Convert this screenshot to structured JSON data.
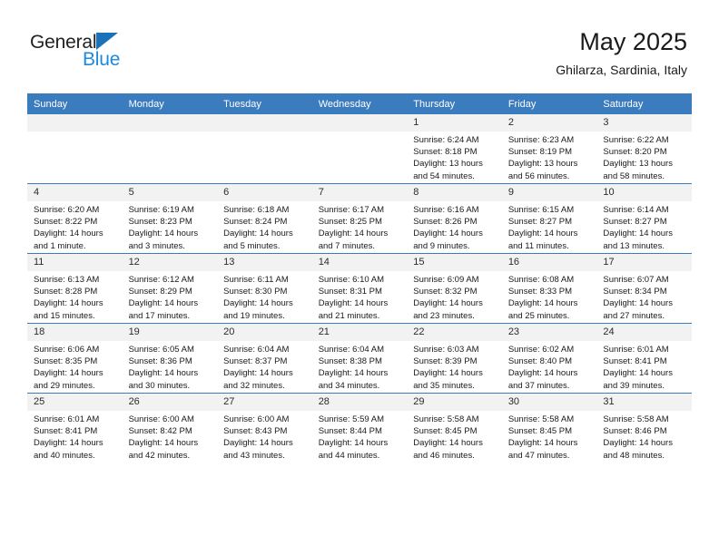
{
  "brand": {
    "word1": "General",
    "word2": "Blue",
    "triangle_color": "#1b72b8",
    "blue_text_color": "#1b8ae0"
  },
  "header": {
    "title": "May 2025",
    "subtitle": "Ghilarza, Sardinia, Italy"
  },
  "theme": {
    "header_blue": "#3b7cbf",
    "daynum_bg": "#f2f2f2",
    "text": "#1a1a1a"
  },
  "weekdays": [
    "Sunday",
    "Monday",
    "Tuesday",
    "Wednesday",
    "Thursday",
    "Friday",
    "Saturday"
  ],
  "weeks": [
    [
      {
        "day": "",
        "empty": true
      },
      {
        "day": "",
        "empty": true
      },
      {
        "day": "",
        "empty": true
      },
      {
        "day": "",
        "empty": true
      },
      {
        "day": "1",
        "sunrise": "Sunrise: 6:24 AM",
        "sunset": "Sunset: 8:18 PM",
        "daylight": "Daylight: 13 hours and 54 minutes."
      },
      {
        "day": "2",
        "sunrise": "Sunrise: 6:23 AM",
        "sunset": "Sunset: 8:19 PM",
        "daylight": "Daylight: 13 hours and 56 minutes."
      },
      {
        "day": "3",
        "sunrise": "Sunrise: 6:22 AM",
        "sunset": "Sunset: 8:20 PM",
        "daylight": "Daylight: 13 hours and 58 minutes."
      }
    ],
    [
      {
        "day": "4",
        "sunrise": "Sunrise: 6:20 AM",
        "sunset": "Sunset: 8:22 PM",
        "daylight": "Daylight: 14 hours and 1 minute."
      },
      {
        "day": "5",
        "sunrise": "Sunrise: 6:19 AM",
        "sunset": "Sunset: 8:23 PM",
        "daylight": "Daylight: 14 hours and 3 minutes."
      },
      {
        "day": "6",
        "sunrise": "Sunrise: 6:18 AM",
        "sunset": "Sunset: 8:24 PM",
        "daylight": "Daylight: 14 hours and 5 minutes."
      },
      {
        "day": "7",
        "sunrise": "Sunrise: 6:17 AM",
        "sunset": "Sunset: 8:25 PM",
        "daylight": "Daylight: 14 hours and 7 minutes."
      },
      {
        "day": "8",
        "sunrise": "Sunrise: 6:16 AM",
        "sunset": "Sunset: 8:26 PM",
        "daylight": "Daylight: 14 hours and 9 minutes."
      },
      {
        "day": "9",
        "sunrise": "Sunrise: 6:15 AM",
        "sunset": "Sunset: 8:27 PM",
        "daylight": "Daylight: 14 hours and 11 minutes."
      },
      {
        "day": "10",
        "sunrise": "Sunrise: 6:14 AM",
        "sunset": "Sunset: 8:27 PM",
        "daylight": "Daylight: 14 hours and 13 minutes."
      }
    ],
    [
      {
        "day": "11",
        "sunrise": "Sunrise: 6:13 AM",
        "sunset": "Sunset: 8:28 PM",
        "daylight": "Daylight: 14 hours and 15 minutes."
      },
      {
        "day": "12",
        "sunrise": "Sunrise: 6:12 AM",
        "sunset": "Sunset: 8:29 PM",
        "daylight": "Daylight: 14 hours and 17 minutes."
      },
      {
        "day": "13",
        "sunrise": "Sunrise: 6:11 AM",
        "sunset": "Sunset: 8:30 PM",
        "daylight": "Daylight: 14 hours and 19 minutes."
      },
      {
        "day": "14",
        "sunrise": "Sunrise: 6:10 AM",
        "sunset": "Sunset: 8:31 PM",
        "daylight": "Daylight: 14 hours and 21 minutes."
      },
      {
        "day": "15",
        "sunrise": "Sunrise: 6:09 AM",
        "sunset": "Sunset: 8:32 PM",
        "daylight": "Daylight: 14 hours and 23 minutes."
      },
      {
        "day": "16",
        "sunrise": "Sunrise: 6:08 AM",
        "sunset": "Sunset: 8:33 PM",
        "daylight": "Daylight: 14 hours and 25 minutes."
      },
      {
        "day": "17",
        "sunrise": "Sunrise: 6:07 AM",
        "sunset": "Sunset: 8:34 PM",
        "daylight": "Daylight: 14 hours and 27 minutes."
      }
    ],
    [
      {
        "day": "18",
        "sunrise": "Sunrise: 6:06 AM",
        "sunset": "Sunset: 8:35 PM",
        "daylight": "Daylight: 14 hours and 29 minutes."
      },
      {
        "day": "19",
        "sunrise": "Sunrise: 6:05 AM",
        "sunset": "Sunset: 8:36 PM",
        "daylight": "Daylight: 14 hours and 30 minutes."
      },
      {
        "day": "20",
        "sunrise": "Sunrise: 6:04 AM",
        "sunset": "Sunset: 8:37 PM",
        "daylight": "Daylight: 14 hours and 32 minutes."
      },
      {
        "day": "21",
        "sunrise": "Sunrise: 6:04 AM",
        "sunset": "Sunset: 8:38 PM",
        "daylight": "Daylight: 14 hours and 34 minutes."
      },
      {
        "day": "22",
        "sunrise": "Sunrise: 6:03 AM",
        "sunset": "Sunset: 8:39 PM",
        "daylight": "Daylight: 14 hours and 35 minutes."
      },
      {
        "day": "23",
        "sunrise": "Sunrise: 6:02 AM",
        "sunset": "Sunset: 8:40 PM",
        "daylight": "Daylight: 14 hours and 37 minutes."
      },
      {
        "day": "24",
        "sunrise": "Sunrise: 6:01 AM",
        "sunset": "Sunset: 8:41 PM",
        "daylight": "Daylight: 14 hours and 39 minutes."
      }
    ],
    [
      {
        "day": "25",
        "sunrise": "Sunrise: 6:01 AM",
        "sunset": "Sunset: 8:41 PM",
        "daylight": "Daylight: 14 hours and 40 minutes."
      },
      {
        "day": "26",
        "sunrise": "Sunrise: 6:00 AM",
        "sunset": "Sunset: 8:42 PM",
        "daylight": "Daylight: 14 hours and 42 minutes."
      },
      {
        "day": "27",
        "sunrise": "Sunrise: 6:00 AM",
        "sunset": "Sunset: 8:43 PM",
        "daylight": "Daylight: 14 hours and 43 minutes."
      },
      {
        "day": "28",
        "sunrise": "Sunrise: 5:59 AM",
        "sunset": "Sunset: 8:44 PM",
        "daylight": "Daylight: 14 hours and 44 minutes."
      },
      {
        "day": "29",
        "sunrise": "Sunrise: 5:58 AM",
        "sunset": "Sunset: 8:45 PM",
        "daylight": "Daylight: 14 hours and 46 minutes."
      },
      {
        "day": "30",
        "sunrise": "Sunrise: 5:58 AM",
        "sunset": "Sunset: 8:45 PM",
        "daylight": "Daylight: 14 hours and 47 minutes."
      },
      {
        "day": "31",
        "sunrise": "Sunrise: 5:58 AM",
        "sunset": "Sunset: 8:46 PM",
        "daylight": "Daylight: 14 hours and 48 minutes."
      }
    ]
  ]
}
